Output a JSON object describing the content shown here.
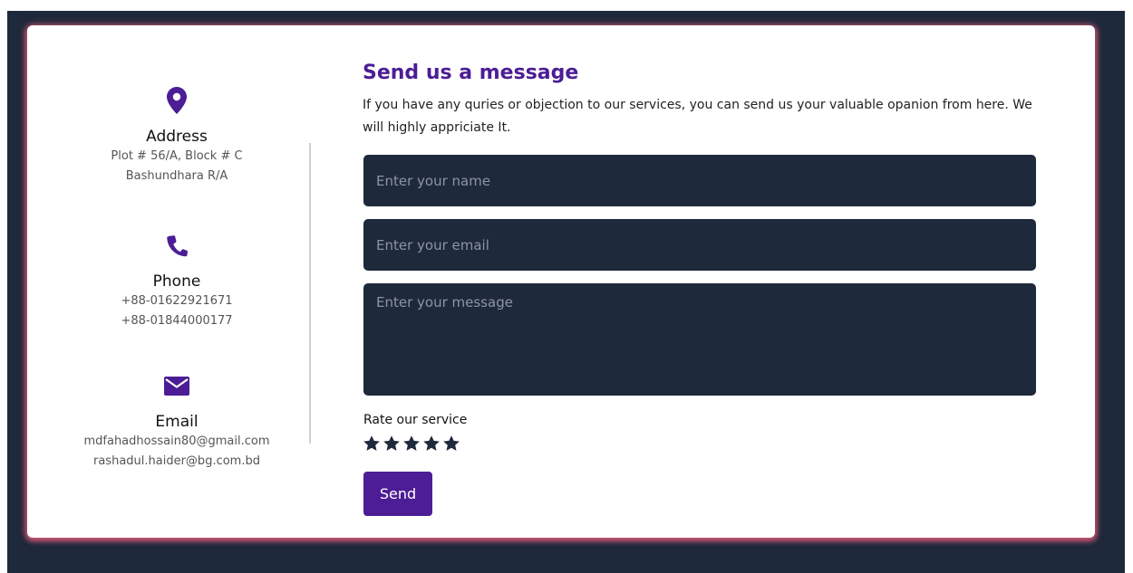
{
  "contact": {
    "address": {
      "icon": "map-marker-icon",
      "title": "Address",
      "lines": [
        "Plot # 56/A, Block # C",
        "Bashundhara R/A"
      ]
    },
    "phone": {
      "icon": "phone-icon",
      "title": "Phone",
      "lines": [
        "+88-01622921671",
        "+88-01844000177"
      ]
    },
    "email": {
      "icon": "envelope-icon",
      "title": "Email",
      "lines": [
        "mdfahadhossain80@gmail.com",
        "rashadul.haider@bg.com.bd"
      ]
    }
  },
  "form": {
    "title": "Send us a message",
    "description": "If you have any quries or objection to our services, you can send us your valuable opanion from here. We will highly appriciate It.",
    "name_placeholder": "Enter your name",
    "name_value": "",
    "email_placeholder": "Enter your email",
    "email_value": "",
    "message_placeholder": "Enter your message",
    "message_value": "",
    "rating_label": "Rate our service",
    "rating_max": 5,
    "send_label": "Send"
  },
  "colors": {
    "accent": "#4c1d95",
    "backdrop": "#1e293b",
    "card_glow": "#e05c7a",
    "star": "#1e293b"
  }
}
